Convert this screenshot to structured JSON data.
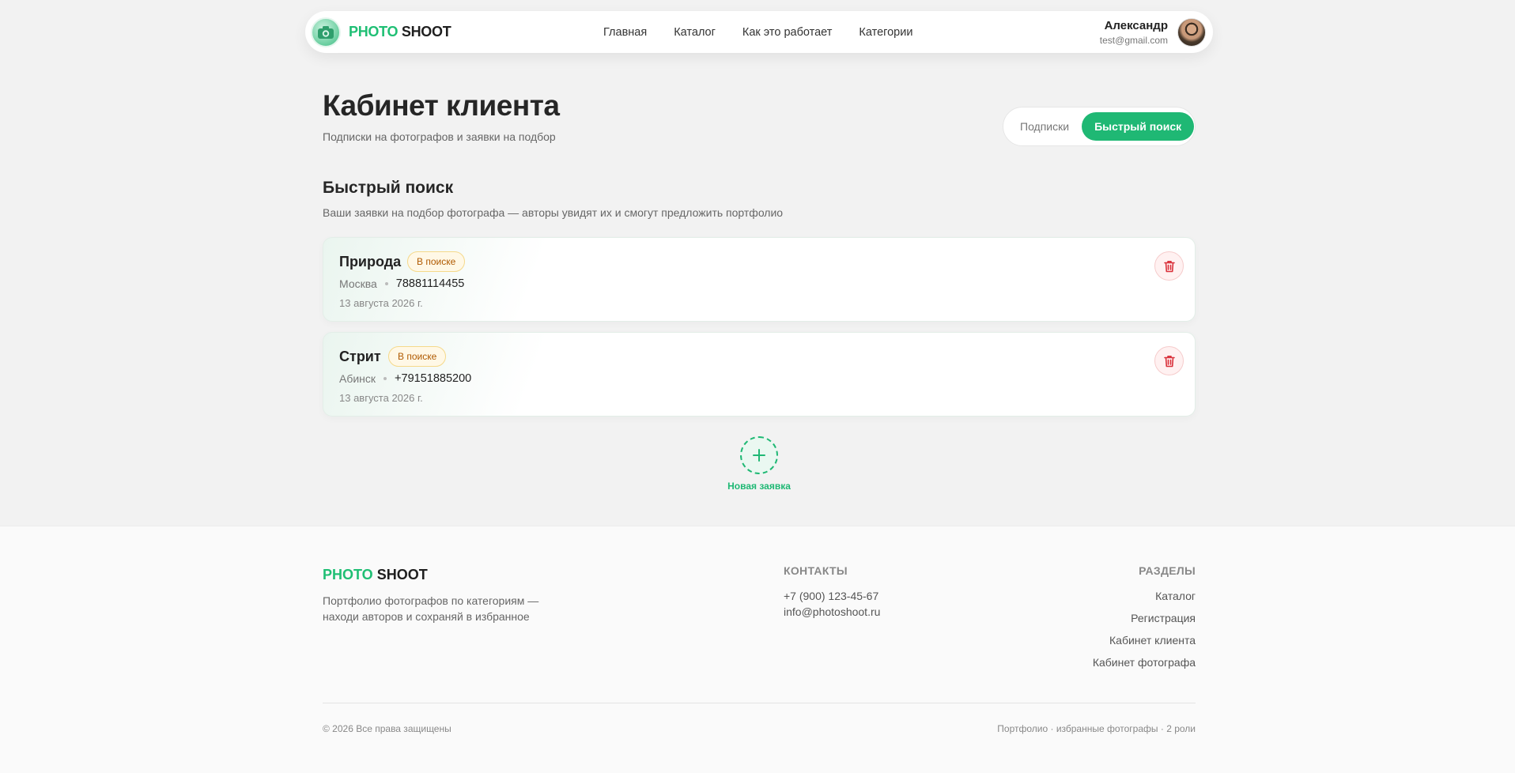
{
  "header": {
    "logo": {
      "part1": "PHOTO",
      "part2": "SHOOT"
    },
    "nav": [
      "Главная",
      "Каталог",
      "Как это работает",
      "Категории"
    ],
    "user": {
      "name": "Александр",
      "email": "test@gmail.com"
    }
  },
  "page": {
    "title": "Кабинет клиента",
    "subtitle": "Подписки на фотографов и заявки на подбор",
    "tabs": [
      {
        "label": "Подписки",
        "active": false
      },
      {
        "label": "Быстрый поиск",
        "active": true
      }
    ]
  },
  "section": {
    "title": "Быстрый поиск",
    "description": "Ваши заявки на подбор фотографа — авторы увидят их и смогут предложить портфолио"
  },
  "requests": [
    {
      "title": "Природа",
      "status": "В поиске",
      "city": "Москва",
      "phone": "78881114455",
      "date": "13 августа 2026 г."
    },
    {
      "title": "Стрит",
      "status": "В поиске",
      "city": "Абинск",
      "phone": "+79151885200",
      "date": "13 августа 2026 г."
    }
  ],
  "add": {
    "label": "Новая заявка"
  },
  "footer": {
    "logo": {
      "part1": "PHOTO",
      "part2": "SHOOT"
    },
    "description": "Портфолио фотографов по категориям — находи авторов и сохраняй в избранное",
    "contacts_title": "КОНТАКТЫ",
    "contacts": [
      "+7 (900) 123-45-67",
      "info@photoshoot.ru"
    ],
    "sections_title": "РАЗДЕЛЫ",
    "sections": [
      "Каталог",
      "Регистрация",
      "Кабинет клиента",
      "Кабинет фотографа"
    ],
    "copyright": "© 2026 Все права защищены",
    "tagline": "Портфолио · избранные фотографы · 2 роли"
  },
  "colors": {
    "accent": "#1fb874",
    "badge_text": "#b05a00",
    "delete": "#d9303a"
  },
  "icons": {
    "logo": "camera-logo-icon",
    "delete": "trash-icon",
    "add": "plus-icon"
  }
}
